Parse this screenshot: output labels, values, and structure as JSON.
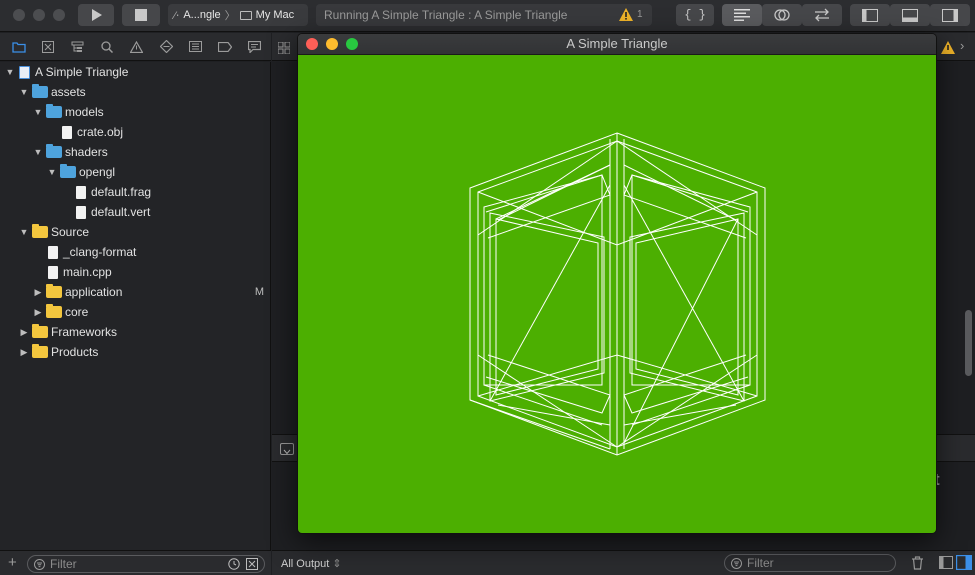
{
  "toolbar": {
    "scheme_target": "A...ngle",
    "destination": "My Mac",
    "activity_text": "Running A Simple Triangle : A Simple Triangle",
    "warning_count": "1",
    "braces_label": "{ }"
  },
  "navigator": {
    "items": [
      {
        "label": "A Simple Triangle",
        "kind": "project",
        "level": 0,
        "open": true
      },
      {
        "label": "assets",
        "kind": "folder-blue",
        "level": 1,
        "open": true
      },
      {
        "label": "models",
        "kind": "folder-blue",
        "level": 2,
        "open": true
      },
      {
        "label": "crate.obj",
        "kind": "file",
        "level": 3
      },
      {
        "label": "shaders",
        "kind": "folder-blue",
        "level": 2,
        "open": true
      },
      {
        "label": "opengl",
        "kind": "folder-blue",
        "level": 3,
        "open": true
      },
      {
        "label": "default.frag",
        "kind": "file",
        "level": 4
      },
      {
        "label": "default.vert",
        "kind": "file",
        "level": 4
      },
      {
        "label": "Source",
        "kind": "folder-yellow",
        "level": 1,
        "open": true
      },
      {
        "label": "_clang-format",
        "kind": "file",
        "level": 2
      },
      {
        "label": "main.cpp",
        "kind": "file",
        "level": 2
      },
      {
        "label": "application",
        "kind": "folder-yellow",
        "level": 2,
        "open": false,
        "badge": "M"
      },
      {
        "label": "core",
        "kind": "folder-yellow",
        "level": 2,
        "open": false
      },
      {
        "label": "Frameworks",
        "kind": "folder-yellow",
        "level": 1,
        "open": false
      },
      {
        "label": "Products",
        "kind": "folder-yellow",
        "level": 1,
        "open": false
      }
    ],
    "filter_placeholder": "Filter"
  },
  "console": {
    "output_selector": "All Output",
    "filter_placeholder": "Filter"
  },
  "app_window": {
    "title": "A Simple Triangle",
    "canvas_color": "#4caf01"
  },
  "colors": {
    "accent": "#3b8fe8",
    "close": "#fe5f57",
    "minimize": "#febc2e",
    "zoom": "#28c840"
  }
}
